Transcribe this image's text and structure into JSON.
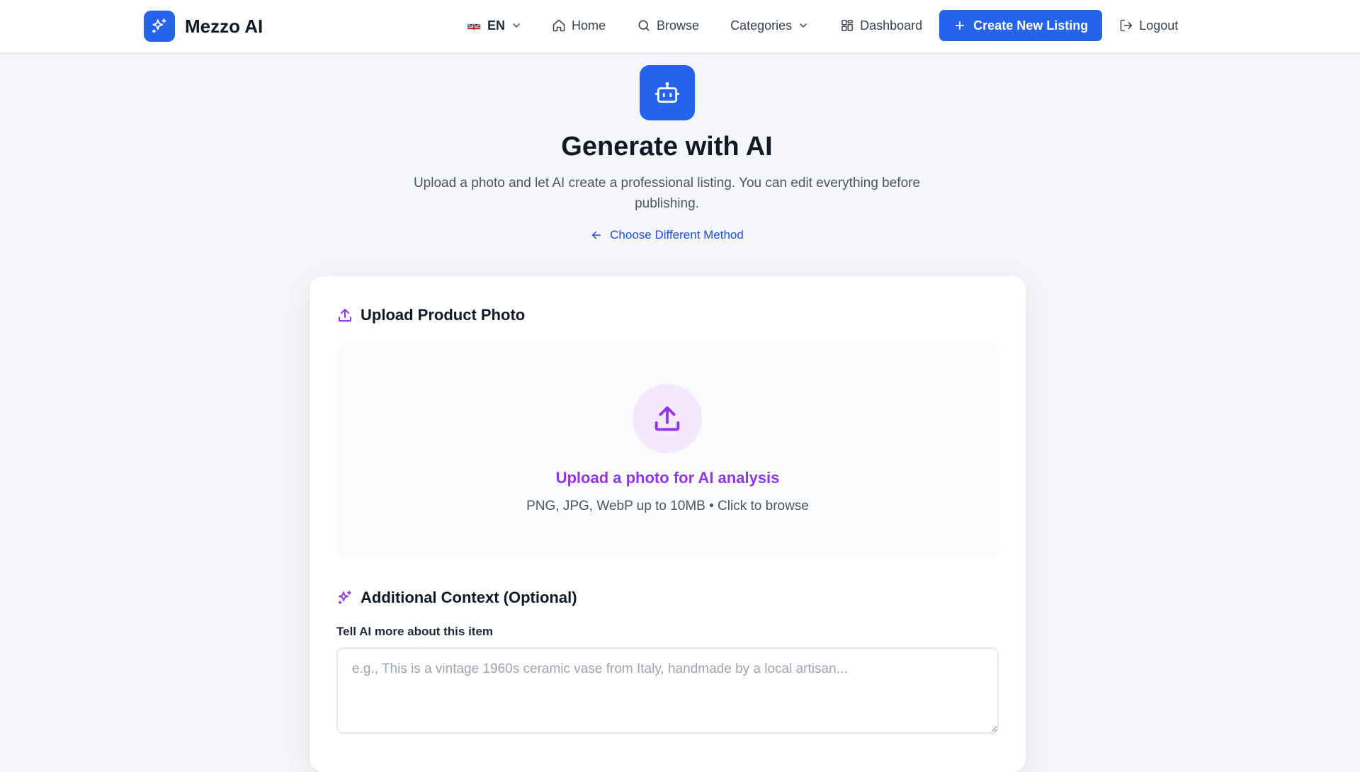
{
  "brand": {
    "name": "Mezzo AI"
  },
  "nav": {
    "language": "EN",
    "home": "Home",
    "browse": "Browse",
    "categories": "Categories",
    "dashboard": "Dashboard",
    "create": "Create New Listing",
    "logout": "Logout"
  },
  "hero": {
    "title": "Generate with AI",
    "subtitle": "Upload a photo and let AI create a professional listing. You can edit everything before publishing.",
    "back_link": "Choose Different Method"
  },
  "upload": {
    "section_title": "Upload Product Photo",
    "dropzone_title": "Upload a photo for AI analysis",
    "dropzone_hint": "PNG, JPG, WebP up to 10MB • Click to browse"
  },
  "context": {
    "section_title": "Additional Context (Optional)",
    "label": "Tell AI more about this item",
    "placeholder": "e.g., This is a vintage 1960s ceramic vase from Italy, handmade by a local artisan...",
    "value": ""
  },
  "icons": {
    "brand": "sparkles-icon",
    "language_flag": "uk-flag-icon",
    "home": "home-icon",
    "browse": "search-icon",
    "dashboard": "dashboard-grid-icon",
    "create": "plus-icon",
    "logout": "logout-icon",
    "hero": "robot-icon",
    "back": "arrow-left-icon",
    "upload": "upload-icon",
    "context": "sparkles-icon"
  },
  "colors": {
    "primary": "#2563eb",
    "accent_purple": "#9333ea",
    "page_background": "#f4f6fa"
  }
}
